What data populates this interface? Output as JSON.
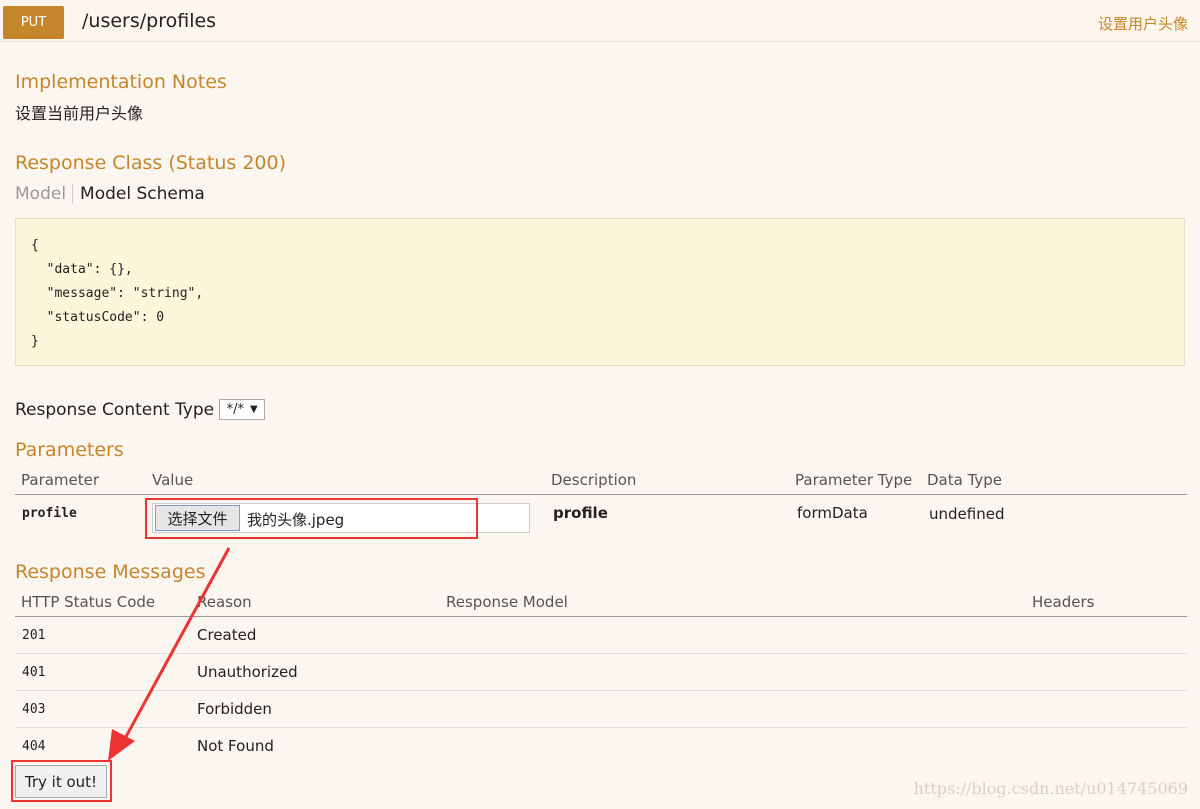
{
  "header": {
    "method": "PUT",
    "path": "/users/profiles",
    "summary": "设置用户头像"
  },
  "implementation": {
    "title": "Implementation Notes",
    "text": "设置当前用户头像"
  },
  "response_class": {
    "title": "Response Class (Status 200)",
    "tab_model": "Model",
    "tab_schema": "Model Schema",
    "schema": "{\n  \"data\": {},\n  \"message\": \"string\",\n  \"statusCode\": 0\n}"
  },
  "response_content_type": {
    "label": "Response Content Type",
    "value": "*/*"
  },
  "parameters": {
    "title": "Parameters",
    "columns": [
      "Parameter",
      "Value",
      "Description",
      "Parameter Type",
      "Data Type"
    ],
    "row": {
      "name": "profile",
      "file_button": "选择文件",
      "file_name": "我的头像.jpeg",
      "description": "profile",
      "param_type": "formData",
      "data_type": "undefined"
    }
  },
  "response_messages": {
    "title": "Response Messages",
    "columns": [
      "HTTP Status Code",
      "Reason",
      "Response Model",
      "Headers"
    ],
    "rows": [
      {
        "code": "201",
        "reason": "Created"
      },
      {
        "code": "401",
        "reason": "Unauthorized"
      },
      {
        "code": "403",
        "reason": "Forbidden"
      },
      {
        "code": "404",
        "reason": "Not Found"
      }
    ]
  },
  "try_button": "Try it out!",
  "watermark": "https://blog.csdn.net/u014745069",
  "colors": {
    "accent": "#c5862b",
    "background": "#fcf6f0",
    "schema_bg": "#fcf6db",
    "highlight": "#e33333"
  }
}
